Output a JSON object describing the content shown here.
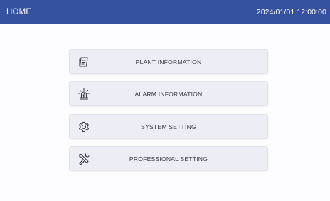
{
  "header": {
    "title": "HOME",
    "datetime": "2024/01/01 12:00:00",
    "background_color": "#35519f",
    "text_color": "#ffffff"
  },
  "menu": {
    "items": [
      {
        "label": "PLANT INFORMATION",
        "icon": "document-icon"
      },
      {
        "label": "ALARM INFORMATION",
        "icon": "alarm-light-icon"
      },
      {
        "label": "SYSTEM SETTING",
        "icon": "gear-icon"
      },
      {
        "label": "PROFESSIONAL SETTING",
        "icon": "tools-icon"
      }
    ],
    "button_color": "#ededf5",
    "label_color": "#3a3a44"
  }
}
